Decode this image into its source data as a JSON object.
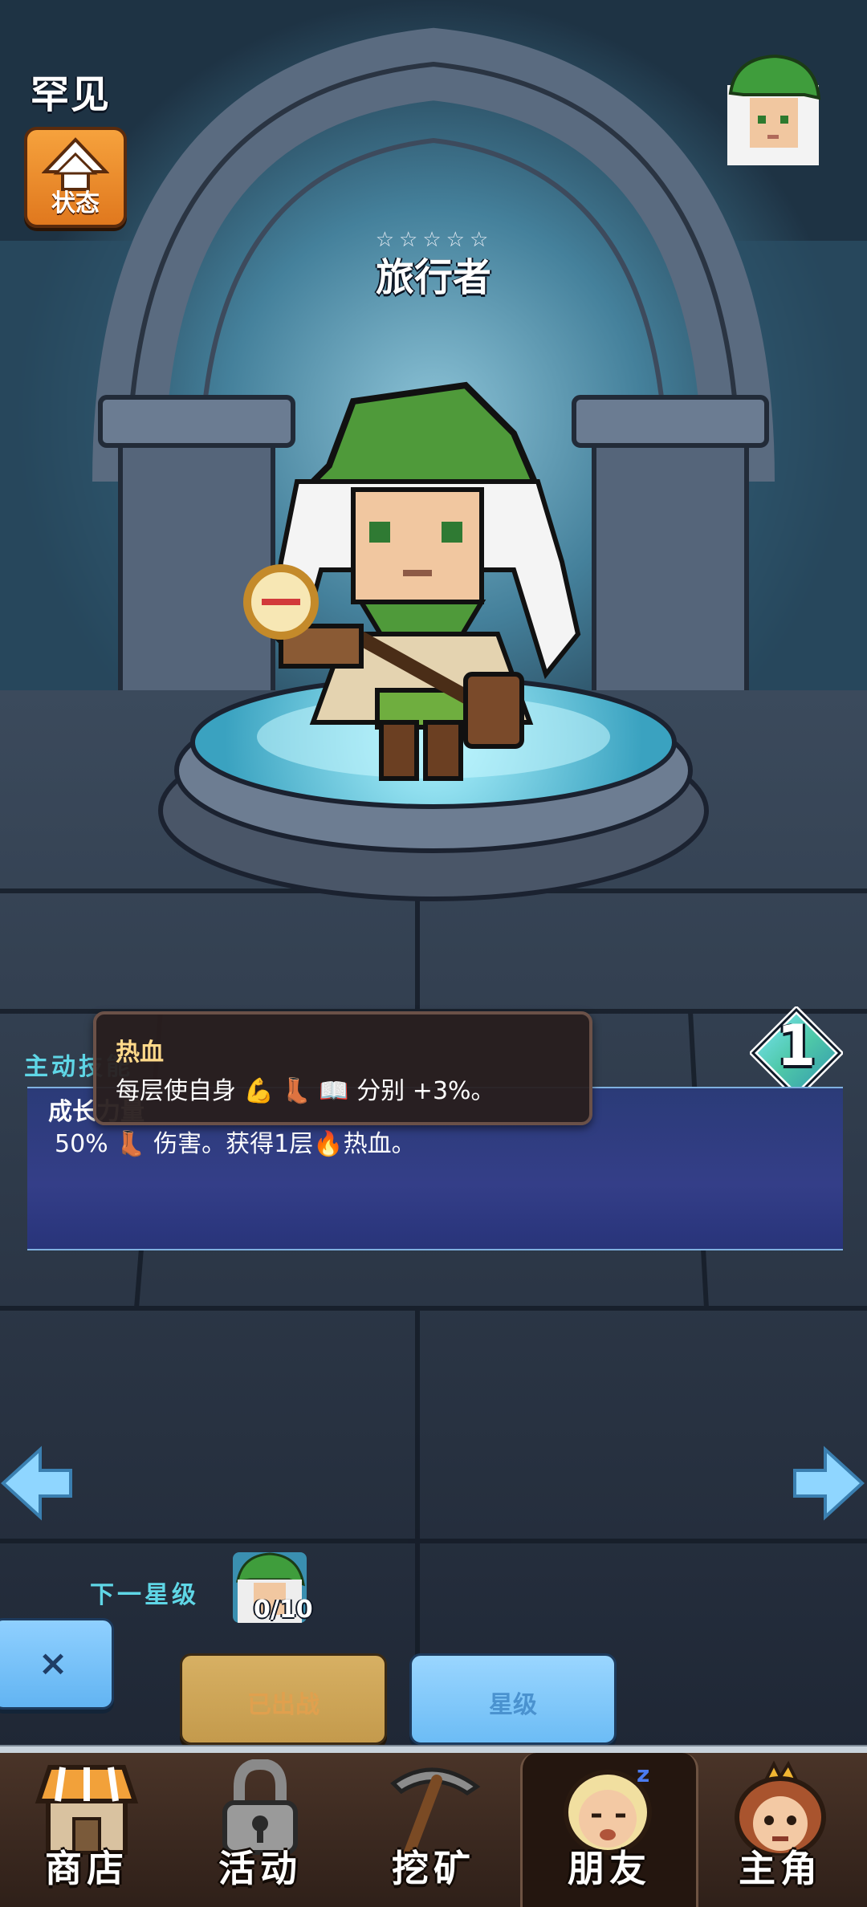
{
  "header": {
    "rarity": "罕见",
    "status_label": "状态",
    "stars": "☆☆☆☆☆",
    "hero_name": "旅行者"
  },
  "level": "1",
  "skill": {
    "section_title": "主动技能",
    "name": "成长力量",
    "description": "50% ⬚ 伤害。获得1层⬚热血。",
    "desc_parts": [
      "50%",
      "伤害。获得1层",
      "热血。"
    ]
  },
  "tooltip": {
    "title": "热血",
    "desc_prefix": "每层使自身",
    "desc_suffix": "分别 +3%。"
  },
  "next_star": {
    "label": "下一星级",
    "progress": "0/10"
  },
  "buttons": {
    "close": "×",
    "deployed": "已出战",
    "star": "星级"
  },
  "nav": {
    "items": [
      {
        "label": "商店",
        "icon": "shop-icon"
      },
      {
        "label": "活动",
        "icon": "lock-icon"
      },
      {
        "label": "挖矿",
        "icon": "pickaxe-icon"
      },
      {
        "label": "朋友",
        "icon": "friend-icon"
      },
      {
        "label": "主角",
        "icon": "hero-icon"
      }
    ],
    "active": "朋友"
  },
  "colors": {
    "accent_cyan": "#5fd6e6",
    "orange_button": "#f6a23d",
    "blue_button": "#6cbcf5",
    "gold_button": "#c49a4c"
  }
}
